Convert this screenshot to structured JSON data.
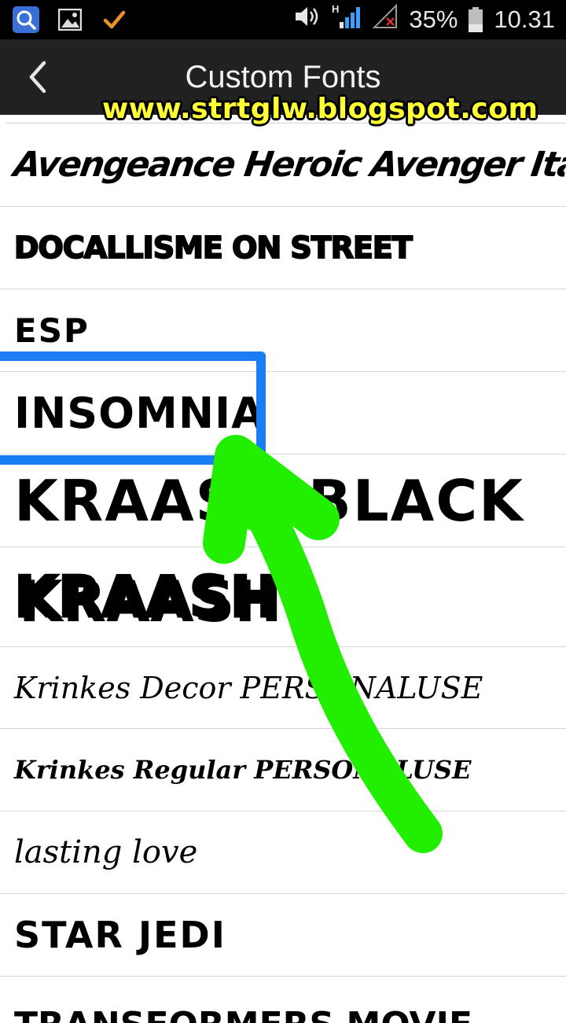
{
  "status_bar": {
    "battery": "35%",
    "time": "10.31",
    "battery_level": 0.35,
    "icons": [
      "search-icon",
      "image-icon",
      "check-icon",
      "volume-icon",
      "signal-h-icon",
      "no-signal-icon",
      "battery-icon"
    ]
  },
  "action_bar": {
    "title": "Custom Fonts",
    "back_icon": "back-chevron-icon"
  },
  "watermark": "www.strtglw.blogspot.com",
  "fonts": [
    "Avengeance Heroic Avenger Italic",
    "DOCALLISME ON STREET",
    "ESP",
    "INSOMNIA",
    "KRAASH BLACK",
    "KRAASH",
    "Krinkes Decor PERSONALUSE",
    "Krinkes Regular PERSONALUSE",
    "lasting love",
    "STAR JEDI",
    "TRANSFORMERS MOVIE"
  ],
  "annotation": {
    "highlight_color": "#1a7ef2",
    "arrow_color": "#22ee00"
  },
  "colors": {
    "status_bar": "#000000",
    "action_bar": "#212121",
    "watermark": "#ffff33",
    "divider": "#d6d6d6"
  }
}
